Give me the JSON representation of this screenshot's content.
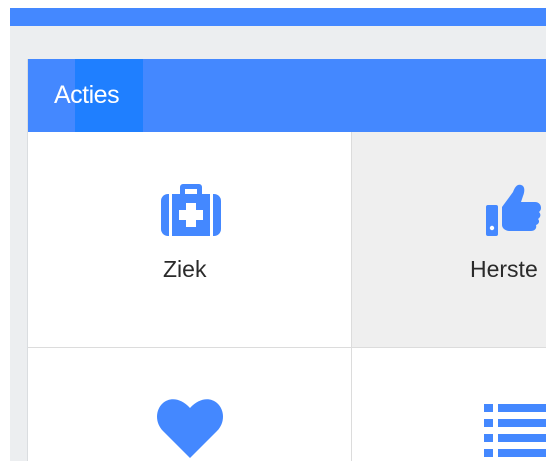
{
  "panel": {
    "title": "Acties"
  },
  "tiles": [
    {
      "label": "Ziek",
      "icon": "medical-kit-icon"
    },
    {
      "label": "Herste",
      "icon": "thumbs-up-icon"
    },
    {
      "label": "",
      "icon": "heart-icon"
    },
    {
      "label": "",
      "icon": "list-icon"
    }
  ],
  "colors": {
    "accent": "#4488ff",
    "accent_dark": "#1f7fff",
    "background": "#eceef0"
  }
}
